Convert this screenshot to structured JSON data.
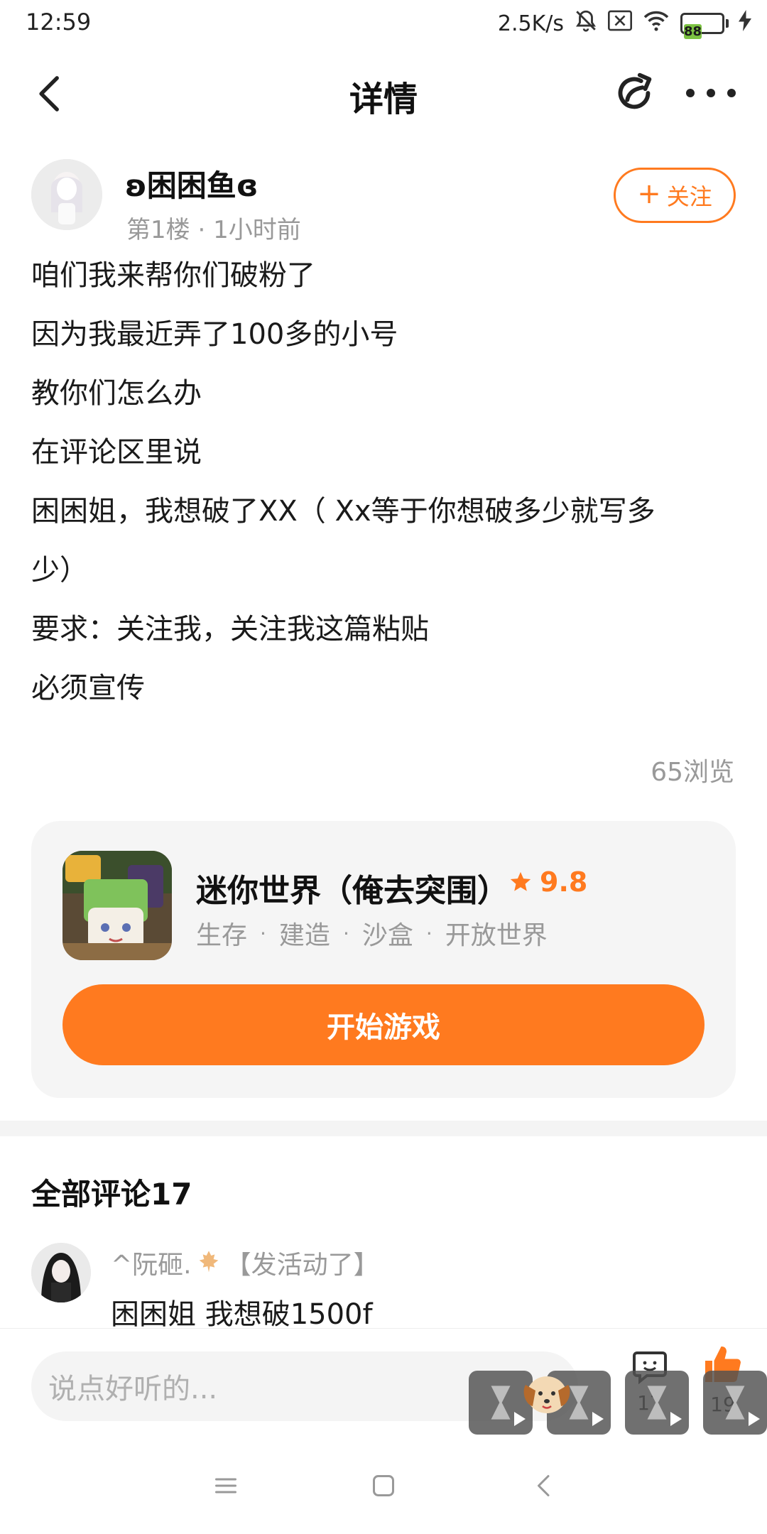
{
  "status_bar": {
    "time": "12:59",
    "network_speed": "2.5K/s",
    "battery_level": "88",
    "icons": [
      "bell-off-icon",
      "sim-x-icon",
      "wifi-icon",
      "battery-icon",
      "charging-icon"
    ]
  },
  "nav": {
    "title": "详情",
    "icons": [
      "back-arrow-icon",
      "share-icon",
      "more-icon"
    ]
  },
  "post": {
    "author_name": "ʚ困困鱼ɞ",
    "floor": "第1楼",
    "time_ago": "1小时前",
    "meta_sep": " · ",
    "follow_label": "关注",
    "lines": [
      "咱们我来帮你们破粉了",
      "因为我最近弄了100多的小号",
      "教你们怎么办",
      "在评论区里说",
      "困困姐，我想破了XX（ Xx等于你想破多少就写多",
      "少）",
      "要求：关注我，关注我这篇粘贴",
      "必须宣传"
    ],
    "views": "65浏览"
  },
  "game_card": {
    "title": "迷你世界（俺去突围）",
    "rating": "9.8",
    "tags": [
      "生存",
      "建造",
      "沙盒",
      "开放世界"
    ],
    "tag_sep": "·",
    "play_label": "开始游戏",
    "accent_color": "#ff7a1f"
  },
  "comments": {
    "header": "全部评论17",
    "items": [
      {
        "user": "^阮砸.",
        "badge": "【发活动了】",
        "text": "困困姐 我想破1500f"
      }
    ]
  },
  "input_bar": {
    "placeholder": "说点好听的...",
    "comment_count": "17",
    "like_count": "19"
  }
}
